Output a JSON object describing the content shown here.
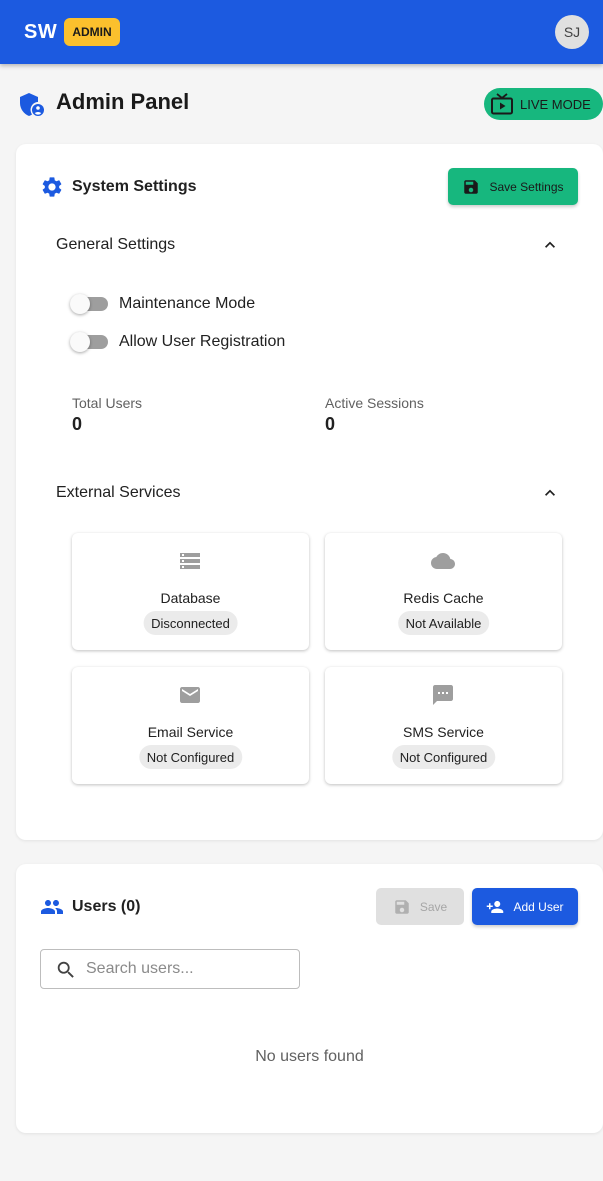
{
  "appbar": {
    "brand": "SW",
    "role_badge": "ADMIN",
    "avatar_initials": "SJ"
  },
  "page": {
    "title": "Admin Panel",
    "mode_chip": "LIVE MODE"
  },
  "system_settings": {
    "title": "System Settings",
    "save_label": "Save Settings",
    "general": {
      "title": "General Settings",
      "expanded": true,
      "toggles": [
        {
          "label": "Maintenance Mode",
          "on": false
        },
        {
          "label": "Allow User Registration",
          "on": false
        }
      ],
      "stats": [
        {
          "label": "Total Users",
          "value": "0"
        },
        {
          "label": "Active Sessions",
          "value": "0"
        }
      ]
    },
    "external": {
      "title": "External Services",
      "expanded": true,
      "services": [
        {
          "name": "Database",
          "status": "Disconnected",
          "icon": "storage-icon"
        },
        {
          "name": "Redis Cache",
          "status": "Not Available",
          "icon": "cloud-icon"
        },
        {
          "name": "Email Service",
          "status": "Not Configured",
          "icon": "email-icon"
        },
        {
          "name": "SMS Service",
          "status": "Not Configured",
          "icon": "sms-icon"
        }
      ]
    }
  },
  "users": {
    "title": "Users (0)",
    "save_label": "Save",
    "add_label": "Add User",
    "search_placeholder": "Search users...",
    "empty_text": "No users found"
  },
  "colors": {
    "primary": "#1c5ae0",
    "success": "#17b77e",
    "badge": "#fbc02d",
    "background": "#f5f5f5"
  }
}
